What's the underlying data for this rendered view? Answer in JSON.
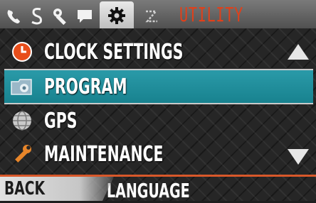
{
  "header": {
    "title": "UTILITY",
    "tabs": [
      {
        "icon": "phone-icon"
      },
      {
        "icon": "audio-icon"
      },
      {
        "icon": "wrench-icon"
      },
      {
        "icon": "message-icon"
      },
      {
        "icon": "gear-icon",
        "active": true
      },
      {
        "icon": "shuffle-icon"
      }
    ]
  },
  "menu": {
    "items": [
      {
        "label": "CLOCK SETTINGS",
        "icon": "clock-icon"
      },
      {
        "label": "PROGRAM",
        "icon": "program-icon",
        "selected": true
      },
      {
        "label": "GPS",
        "icon": "globe-icon"
      },
      {
        "label": "MAINTENANCE",
        "icon": "wrench-icon"
      },
      {
        "label": "LANGUAGE",
        "icon": "language-icon"
      }
    ]
  },
  "softkeys": {
    "back_label": "BACK"
  },
  "colors": {
    "accent": "#e0401a",
    "selection": "#1f8d9a",
    "text": "#ffffff"
  }
}
